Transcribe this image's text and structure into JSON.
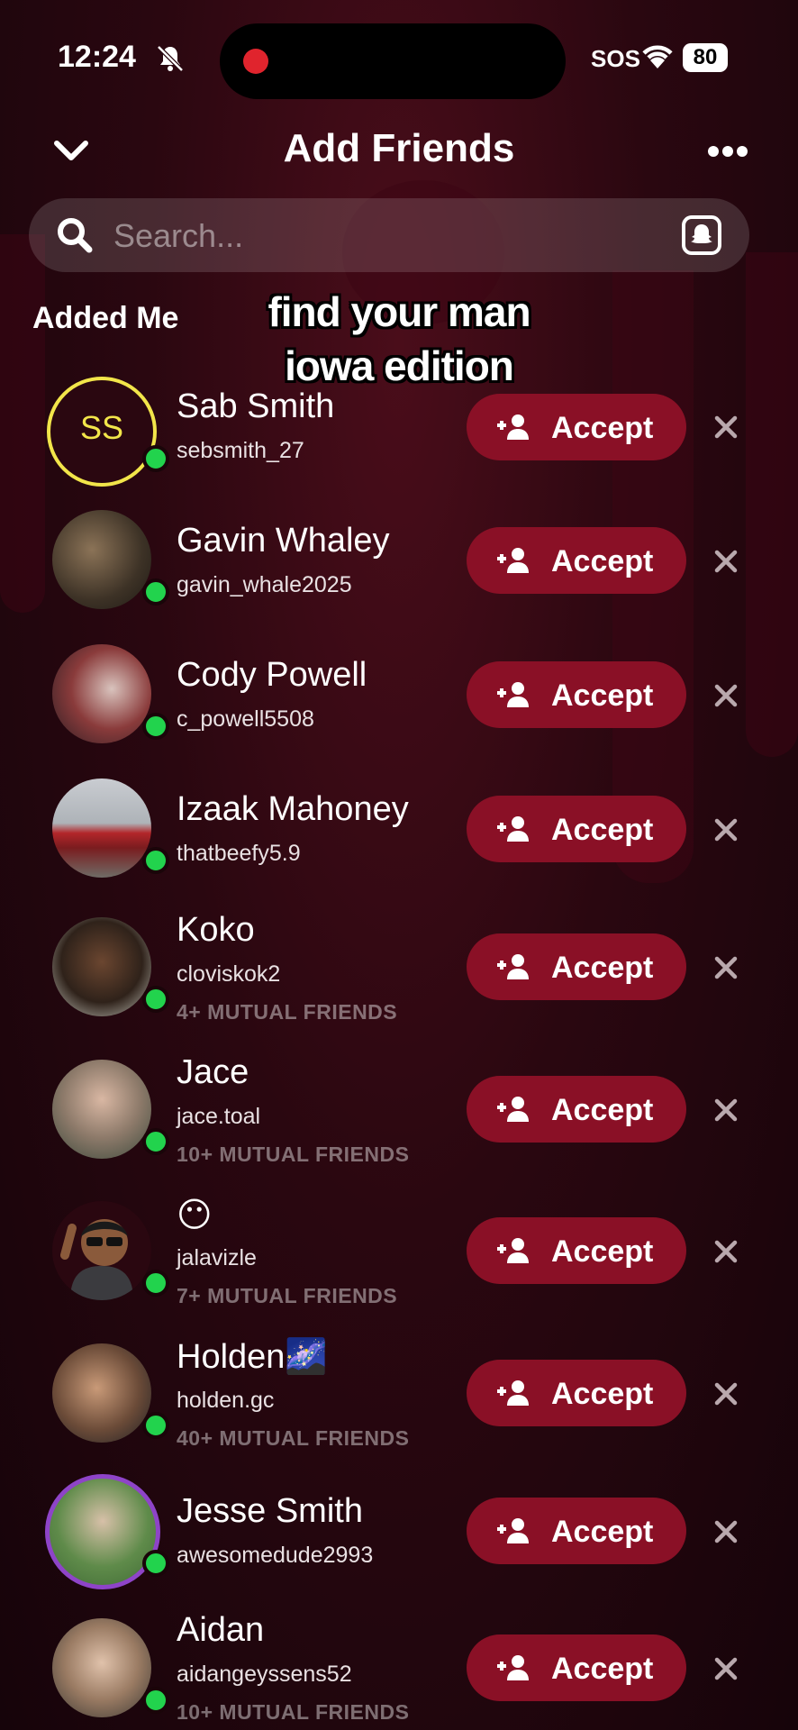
{
  "status": {
    "time": "12:24",
    "sos": "SOS",
    "battery": "80"
  },
  "header": {
    "title": "Add Friends"
  },
  "search": {
    "placeholder": "Search..."
  },
  "section_label": "Added Me",
  "caption": {
    "line1": "find your man",
    "line2": "iowa edition"
  },
  "accept_label": "Accept",
  "colors": {
    "accent": "#8a1026",
    "online": "#22d34d",
    "bg": "#2a0710"
  },
  "requests": [
    {
      "name": "Sab Smith",
      "username": "sebsmith_27",
      "mutual": "",
      "avatar": "initials",
      "initials": "SS"
    },
    {
      "name": "Gavin Whaley",
      "username": "gavin_whale2025",
      "mutual": "",
      "avatar": "photo"
    },
    {
      "name": "Cody Powell",
      "username": "c_powell5508",
      "mutual": "",
      "avatar": "photo"
    },
    {
      "name": "Izaak Mahoney",
      "username": "thatbeefy5.9",
      "mutual": "",
      "avatar": "photo"
    },
    {
      "name": "Koko",
      "username": "cloviskok2",
      "mutual": "4+ MUTUAL FRIENDS",
      "avatar": "photo"
    },
    {
      "name": "Jace",
      "username": "jace.toal",
      "mutual": "10+ MUTUAL FRIENDS",
      "avatar": "photo"
    },
    {
      "name": "😶",
      "username": "jalavizle",
      "mutual": "7+ MUTUAL FRIENDS",
      "avatar": "bitmoji"
    },
    {
      "name": "Holden🌌",
      "username": "holden.gc",
      "mutual": "40+ MUTUAL FRIENDS",
      "avatar": "photo"
    },
    {
      "name": "Jesse Smith",
      "username": "awesomedude2993",
      "mutual": "",
      "avatar": "photo-ring"
    },
    {
      "name": "Aidan",
      "username": "aidangeyssens52",
      "mutual": "10+ MUTUAL FRIENDS",
      "avatar": "photo"
    }
  ]
}
